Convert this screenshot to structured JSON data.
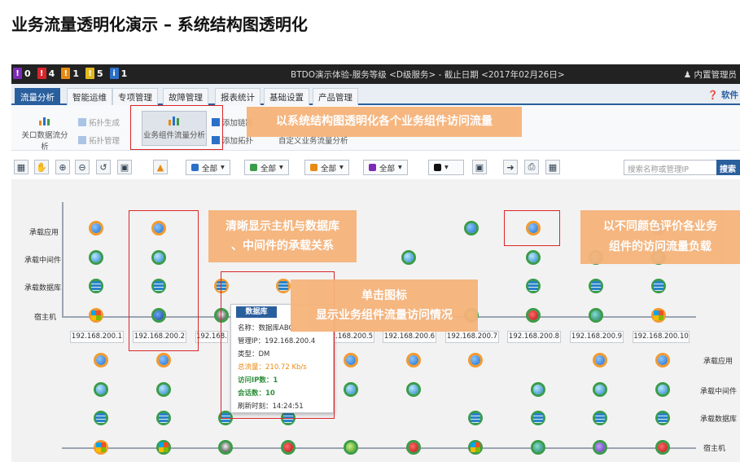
{
  "title": "业务流量透明化演示 – 系统结构图透明化",
  "statusbar": {
    "alerts": [
      {
        "count": "0",
        "color": "#7c2bb7"
      },
      {
        "count": "4",
        "color": "#d9262b"
      },
      {
        "count": "1",
        "color": "#e88a12"
      },
      {
        "count": "5",
        "color": "#e3b81e"
      },
      {
        "count": "1",
        "color": "#2a70c8"
      }
    ],
    "center_text": "BTDO演示体验-服务等级 <D级服务> - 截止日期 <2017年02月26日>",
    "user": "内置管理员"
  },
  "tabs": [
    "流量分析",
    "智能运维",
    "专项管理",
    "故障管理",
    "报表统计",
    "基础设置",
    "产品管理"
  ],
  "help_label": "软件",
  "ribbon": {
    "btn1": "关口数据流分析",
    "btn2a": "拓扑生成",
    "btn2b": "拓扑管理",
    "btn3": "业务组件流量分析",
    "btn4a": "添加链路",
    "btn4b": "添加拓扑",
    "btn5": "自定义业务流量分析"
  },
  "toolbar": {
    "sel1": "全部",
    "sel2": "全部",
    "sel3": "全部",
    "sel4": "全部",
    "search_placeholder": "搜索名称或管理IP",
    "search_btn": "搜索"
  },
  "canvas": {
    "row_labels_left": [
      "承载应用",
      "承载中间件",
      "承载数据库",
      "宿主机"
    ],
    "row_labels_right": [
      "承载应用",
      "承载中间件",
      "承载数据库",
      "宿主机"
    ],
    "ips": [
      "192.168.200.1",
      "192.168.200.2",
      "192.168.200.3",
      "192.168.200.4",
      "192.168.200.5",
      "192.168.200.6",
      "192.168.200.7",
      "192.168.200.8",
      "192.168.200.9",
      "192.168.200.10"
    ]
  },
  "popup": {
    "header": "数据库",
    "name": "名称：数据库ABC",
    "ip": "管理IP：192.168.200.4",
    "type": "类型：DM",
    "traffic": "总流量：210.72 Kb/s",
    "visit_ip": "访问IP数：1",
    "sessions": "会话数：10",
    "refresh": "刷新时刻：14:24:51"
  },
  "callouts": {
    "c1": "以系统结构图透明化各个业务组件访问流量",
    "c2a": "清晰显示主机与数据库",
    "c2b": "、中间件的承载关系",
    "c3a": "单击图标",
    "c3b": "显示业务组件流量访问情况",
    "c4a": "以不同颜色评价各业务",
    "c4b": "组件的访问流量负载"
  }
}
